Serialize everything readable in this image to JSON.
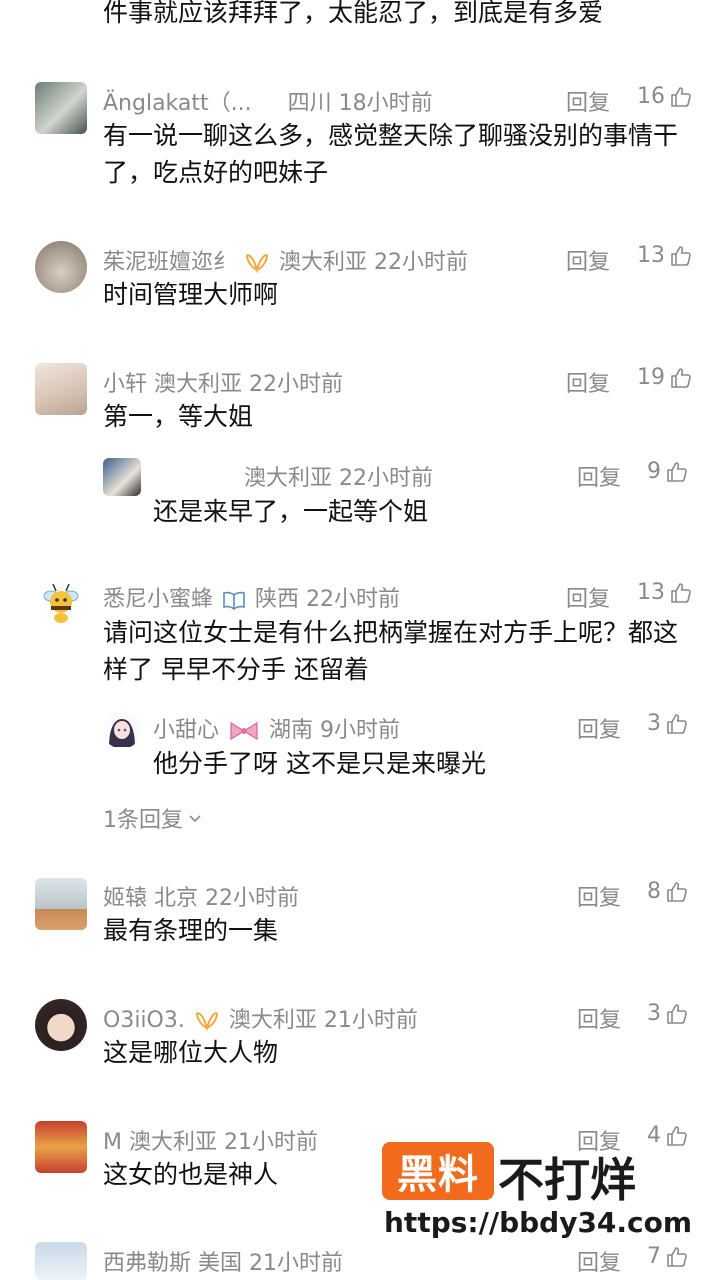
{
  "top_fragment": "件事就应该拜拜了，太能忍了，到底是有多爱",
  "reply_label": "回复",
  "comments": [
    {
      "name": "Änglakatt（...",
      "location": "四川",
      "time": "18小时前",
      "likes": "16",
      "lines": [
        "有一说一聊这么多，感觉整天除了聊骚没别的事情干",
        "了，吃点好的吧妹子"
      ]
    },
    {
      "name": "茱泥班嬗迩纟",
      "location": "澳大利亚",
      "time": "22小时前",
      "likes": "13",
      "lines": [
        "时间管理大师啊"
      ]
    },
    {
      "name": "小轩",
      "location": "澳大利亚",
      "time": "22小时前",
      "likes": "19",
      "lines": [
        "第一，等大姐"
      ],
      "subreply": {
        "name": "",
        "location": "澳大利亚",
        "time": "22小时前",
        "likes": "9",
        "text": "还是来早了，一起等个姐"
      }
    },
    {
      "name": "悉尼小蜜蜂",
      "location": "陕西",
      "time": "22小时前",
      "likes": "13",
      "lines": [
        "请问这位女士是有什么把柄掌握在对方手上呢？都这",
        "样了 早早不分手 还留着"
      ],
      "subreply": {
        "name": "小甜心",
        "location": "湖南",
        "time": "9小时前",
        "likes": "3",
        "text": "他分手了呀 这不是只是来曝光"
      },
      "more_replies": "1条回复"
    },
    {
      "name": "姬辕",
      "location": "北京",
      "time": "22小时前",
      "likes": "8",
      "lines": [
        "最有条理的一集"
      ]
    },
    {
      "name": "O3iiO3.",
      "location": "澳大利亚",
      "time": "21小时前",
      "likes": "3",
      "lines": [
        "这是哪位大人物"
      ]
    },
    {
      "name": "M",
      "location": "澳大利亚",
      "time": "21小时前",
      "likes": "4",
      "lines": [
        "这女的也是神人"
      ]
    },
    {
      "name": "西弗勒斯",
      "location": "美国",
      "time": "21小时前",
      "likes": "7",
      "lines": []
    }
  ],
  "watermark": {
    "logo_text_1": "黑料",
    "logo_text_2": "不打烊",
    "url": "https://bbdy34.com",
    "brand_color": "#f26b1d"
  },
  "colors": {
    "meta": "#8a8a8a",
    "text": "#111111"
  }
}
